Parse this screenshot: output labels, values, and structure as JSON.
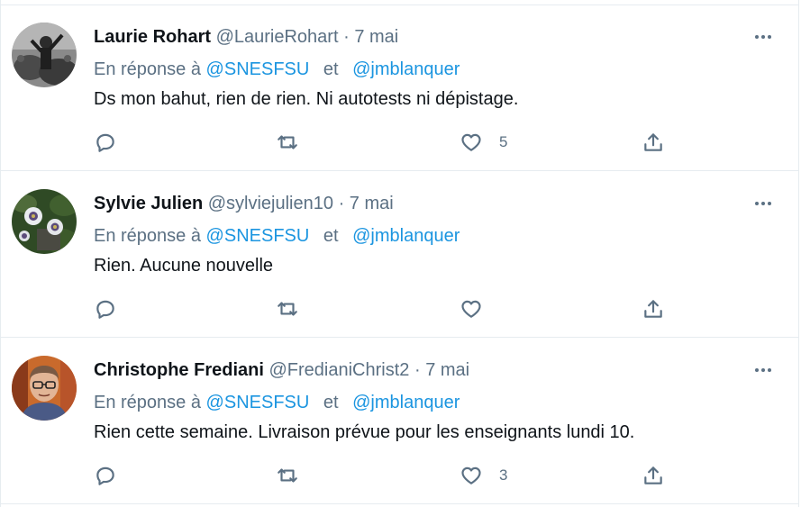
{
  "tweets": [
    {
      "name": "Laurie Rohart",
      "handle": "@LaurieRohart",
      "separator": "·",
      "date": "7 mai",
      "reply_prefix": "En réponse à",
      "reply_to_1": "@SNESFSU",
      "reply_join": "et",
      "reply_to_2": "@jmblanquer",
      "text": "Ds mon bahut, rien de rien. Ni autotests ni dépistage.",
      "likes": "5",
      "avatar": "bw-performer-photo"
    },
    {
      "name": "Sylvie Julien",
      "handle": "@sylviejulien10",
      "separator": "·",
      "date": "7 mai",
      "reply_prefix": "En réponse à",
      "reply_to_1": "@SNESFSU",
      "reply_join": "et",
      "reply_to_2": "@jmblanquer",
      "text": "Rien. Aucune nouvelle",
      "likes": "",
      "avatar": "passion-flower-photo"
    },
    {
      "name": "Christophe Frediani",
      "handle": "@FredianiChrist2",
      "separator": "·",
      "date": "7 mai",
      "reply_prefix": "En réponse à",
      "reply_to_1": "@SNESFSU",
      "reply_join": "et",
      "reply_to_2": "@jmblanquer",
      "text": "Rien cette semaine. Livraison prévue pour les enseignants lundi 10.",
      "likes": "3",
      "avatar": "man-with-glasses-photo"
    }
  ],
  "colors": {
    "link": "#1b95e0",
    "secondary_text": "#5b7083",
    "primary_text": "#0f1419",
    "divider": "#e6ecf0"
  },
  "icons": {
    "more": "more-horizontal-icon",
    "reply": "speech-bubble-icon",
    "retweet": "retweet-arrows-icon",
    "like": "heart-outline-icon",
    "share": "share-upload-icon"
  }
}
